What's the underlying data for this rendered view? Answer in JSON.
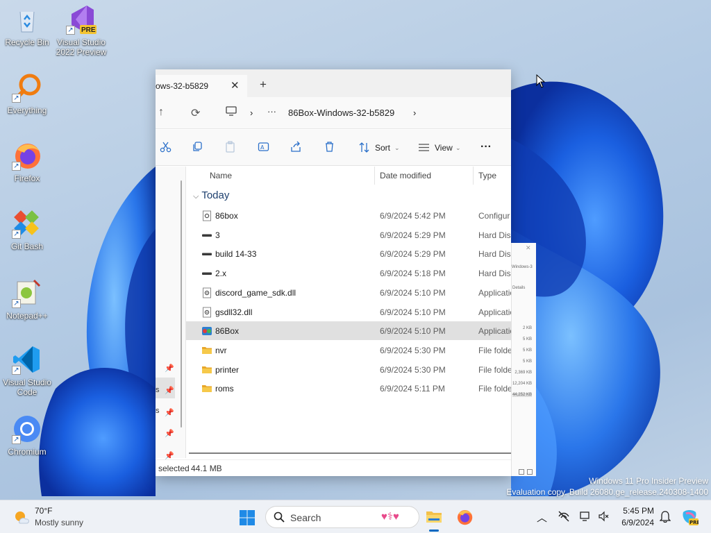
{
  "desktop": {
    "icons": [
      {
        "label": "Recycle Bin"
      },
      {
        "label": "Visual Studio 2022 Preview",
        "badge": "PRE"
      },
      {
        "label": "Everything"
      },
      {
        "label": "Firefox"
      },
      {
        "label": "Git Bash"
      },
      {
        "label": "Notepad++"
      },
      {
        "label": "Visual Studio Code"
      },
      {
        "label": "Chromium"
      }
    ],
    "watermark": {
      "line1": "Windows 11 Pro Insider Preview",
      "line2": "Evaluation copy. Build 26080.ge_release.240308-1400"
    }
  },
  "explorer": {
    "tab_title": "ows-32-b5829",
    "tab_close": "✕",
    "tab_new": "+",
    "address": {
      "up": "↑",
      "refresh": "⟳",
      "sep": "›",
      "overflow": "···",
      "folder": "86Box-Windows-32-b5829",
      "trail": "›"
    },
    "toolbar": {
      "sort_label": "Sort",
      "view_label": "View",
      "more": "···"
    },
    "columns": {
      "name": "Name",
      "date": "Date modified",
      "type": "Type"
    },
    "group_label": "Today",
    "files": [
      {
        "name": "86box",
        "date": "6/9/2024 5:42 PM",
        "type": "Configur",
        "icon": "config-icon",
        "selected": false
      },
      {
        "name": "3",
        "date": "6/9/2024 5:29 PM",
        "type": "Hard Disk",
        "icon": "disk-image-icon",
        "selected": false
      },
      {
        "name": "build 14-33",
        "date": "6/9/2024 5:29 PM",
        "type": "Hard Disk",
        "icon": "disk-image-icon",
        "selected": false
      },
      {
        "name": "2.x",
        "date": "6/9/2024 5:18 PM",
        "type": "Hard Disk",
        "icon": "disk-image-icon",
        "selected": false
      },
      {
        "name": "discord_game_sdk.dll",
        "date": "6/9/2024 5:10 PM",
        "type": "Applicatio",
        "icon": "dll-icon",
        "selected": false
      },
      {
        "name": "gsdll32.dll",
        "date": "6/9/2024 5:10 PM",
        "type": "Applicatio",
        "icon": "dll-icon",
        "selected": false
      },
      {
        "name": "86Box",
        "date": "6/9/2024 5:10 PM",
        "type": "Applicatio",
        "icon": "86box-app-icon",
        "selected": true
      },
      {
        "name": "nvr",
        "date": "6/9/2024 5:30 PM",
        "type": "File folde",
        "icon": "folder-icon",
        "selected": false
      },
      {
        "name": "printer",
        "date": "6/9/2024 5:30 PM",
        "type": "File folde",
        "icon": "folder-icon",
        "selected": false
      },
      {
        "name": "roms",
        "date": "6/9/2024 5:11 PM",
        "type": "File folde",
        "icon": "folder-icon",
        "selected": false
      }
    ],
    "nav_fragments": [
      "s",
      "s"
    ],
    "status": {
      "selected": "selected",
      "size": "44.1 MB"
    }
  },
  "ghost_pane": {
    "title": "Windows-3",
    "details": "Details",
    "sizes": [
      "2 KB",
      "5 KB",
      "5 KB",
      "5 KB",
      "2,369 KB",
      "12,204 KB",
      "44,252 KB"
    ]
  },
  "taskbar": {
    "weather_temp": "70°F",
    "weather_desc": "Mostly sunny",
    "search_placeholder": "Search",
    "clock_time": "5:45 PM",
    "clock_date": "6/9/2024"
  },
  "colors": {
    "accent": "#0067c0",
    "folder": "#f3c04a",
    "selection": "#e0e0e0",
    "wallpaper_blue": "#1b57d6"
  }
}
